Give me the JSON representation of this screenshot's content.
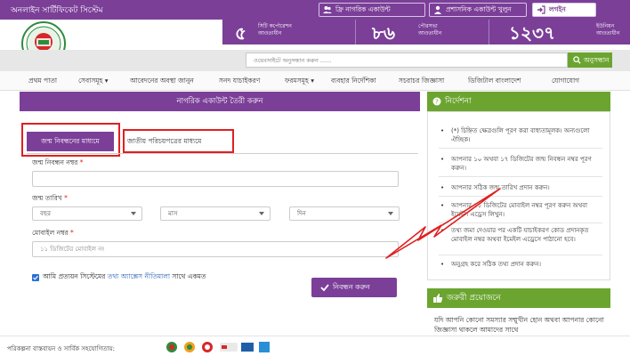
{
  "topbar": {
    "site_title": "অনলাইন সার্টিফিকেট সিস্টেম",
    "citizen_account_button": "ফ্রি নাগরিক একাউন্ট",
    "admin_account_button": "প্রশাসনিক একাউন্ট খুলুন",
    "login_button": "লগইন",
    "accent_color": "#7b3f98"
  },
  "stats": [
    {
      "number": "৫",
      "label_line1": "সিটি কর্পোরেশন",
      "label_line2": "আওতাধীন"
    },
    {
      "number": "৮৬",
      "label_line1": "পৌরসভা",
      "label_line2": "আওতাধীন"
    },
    {
      "number": "১২৩৭",
      "label_line1": "ইউনিয়ন",
      "label_line2": "আওতাধীন"
    }
  ],
  "search": {
    "placeholder": "ওয়েবসাইটে অনুসন্ধান করুন ......",
    "button_label": "অনুসন্ধান"
  },
  "nav": {
    "items": [
      "প্রথম পাতা",
      "সেবাসমূহ ▾",
      "আবেদনের অবস্থা জানুন",
      "সনদ যাচাইকরণ",
      "ফরমসমূহ ▾",
      "ব্যবহার নির্দেশিকা",
      "সচরাচর জিজ্ঞাসা",
      "ডিজিটাল বাংলাদেশ",
      "যোগাযোগ"
    ]
  },
  "form": {
    "header": "নাগরিক একাউন্ট তৈরী করুন",
    "tab_birth": "জন্ম নিবন্ধনের মাধ্যমে",
    "tab_nid": "জাতীয় পরিচয়পত্রের মাধ্যমে",
    "birth_reg_label": "জন্ম নিবন্ধন নম্বর",
    "birth_reg_value": "",
    "dob_label": "জন্ম তারিখ",
    "year_select": "বছর",
    "month_select": "মাস",
    "day_select": "দিন",
    "mobile_label": "মোবাইল নম্বর",
    "mobile_placeholder": "১১ ডিজিটের মোবাইল নং",
    "required_mark": "*",
    "terms_prefix": "আমি প্রত্যয়ন সিস্টেমের",
    "terms_link": "তথ্য অ্যাক্সেস নীতিমালা",
    "terms_suffix": "সাথে একমত",
    "submit_button": "নিবন্ধন করুন"
  },
  "instructions": {
    "header": "নির্দেশনা",
    "items": [
      "(*) চিহ্নিত ক্ষেত্রগুলি পূরণ করা বাধ্যতামূলক। অন্যগুলো ঐচ্ছিক।",
      "আপনার ১০ অথবা ১৭ ডিজিটের জন্ম নিবন্ধন নম্বর পূরণ করুন।",
      "আপনার সঠিক জন্ম তারিখ প্রদান করুন।",
      "আপনার ১১ ডিজিটের মোবাইল নম্বর পূরণ করুন অথবা ইমেইল এড্রেস লিখুন।",
      "তথ্য জমা দেওয়ার পর একটি যাচাইকরণ কোড প্রদানকৃত মোবাইল নম্বর অথবা ইমেইল এড্রেসে পাঠানো হবে।",
      "অনুগ্রহ করে সঠিক তথ্য প্রদান করুন।"
    ],
    "highlight_color": "#e02020"
  },
  "urgent": {
    "header": "জরুরী প্রয়োজনে",
    "text": "যদি আপনি কোনো সমস্যার সম্মুখীন হোন অথবা আপনার কোনো জিজ্ঞাসা থাকলে আমাদের সাথে"
  },
  "footer": {
    "text": "পরিকল্পনা বাস্তবায়ন ও সার্বিক সহযোগিতায়:"
  }
}
